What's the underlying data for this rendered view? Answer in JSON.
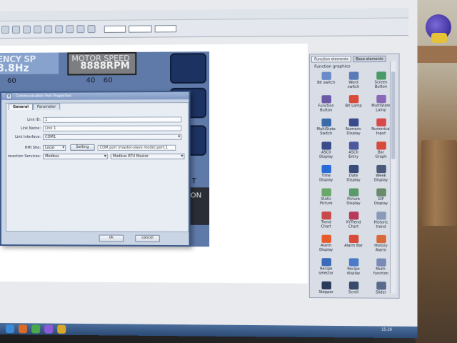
{
  "background": {
    "screen_color": "#e8eaee",
    "hmi_panel_color": "#5f7aa8",
    "accent_dialog": "#3d5a8a"
  },
  "toolbar": {
    "combo_1": "",
    "combo_2": "",
    "combo_3": ""
  },
  "hmi": {
    "frequency_label": "ENCY SP",
    "frequency_value": "8.8Hz",
    "motor_label": "MOTOR SPEED",
    "motor_value": "8888RPM",
    "gauge_left": "60",
    "gauge_mid_a": "40",
    "gauge_mid_b": "60",
    "side_text_1": "T",
    "side_text_2": "ON"
  },
  "dialog": {
    "title": "Communication Port Properties",
    "close_glyph": "×",
    "tabs": [
      {
        "label": "General"
      },
      {
        "label": "Parameter"
      }
    ],
    "fields": {
      "link_id_label": "Link ID:",
      "link_id_value": "1",
      "link_name_label": "Link Name:",
      "link_name_value": "Link 1",
      "link_interface_label": "Link Interface:",
      "link_interface_value": "COM1",
      "hmi_site_label": "HMI Site:",
      "hmi_site_value": "Local",
      "setting_button": "Setting",
      "com_port_text": "COM port (master-slave mode) port:1",
      "connection_services_label": "nnection Services:",
      "connection_services_value": "Modbus",
      "protocol_value": "Modbus RTU Master"
    },
    "ok_label": "ok",
    "cancel_label": "cancel"
  },
  "right_panel": {
    "tabs": [
      {
        "label": "Function elements"
      },
      {
        "label": "Base elements"
      }
    ],
    "heading": "Function graphics",
    "items": [
      {
        "label": "Bit switch",
        "icon": "bit-switch-icon",
        "color": "#6a8bc8"
      },
      {
        "label": "Word\nswitch",
        "icon": "word-switch-icon",
        "color": "#5a7ab8"
      },
      {
        "label": "Screen\nButton",
        "icon": "screen-button-icon",
        "color": "#4a9a6a"
      },
      {
        "label": "Function\nButton",
        "icon": "function-button-icon",
        "color": "#6a5aa8"
      },
      {
        "label": "Bit Lamp",
        "icon": "bit-lamp-icon",
        "color": "#d84a3a"
      },
      {
        "label": "MultiState\nLamp",
        "icon": "multistate-lamp-icon",
        "color": "#8a6ab8"
      },
      {
        "label": "MultiState\nSwitch",
        "icon": "multistate-switch-icon",
        "color": "#3a6aa8"
      },
      {
        "label": "Numeric\nDisplay",
        "icon": "numeric-display-icon",
        "color": "#3a4a8a"
      },
      {
        "label": "Numerical\nInput",
        "icon": "numerical-input-icon",
        "color": "#d84a4a"
      },
      {
        "label": "ASCII\nDisplay",
        "icon": "ascii-display-icon",
        "color": "#3a4a8a"
      },
      {
        "label": "ASCII\nEntry",
        "icon": "ascii-entry-icon",
        "color": "#4a5a9a"
      },
      {
        "label": "Bar\nGraph",
        "icon": "bar-graph-icon",
        "color": "#d84a3a"
      },
      {
        "label": "Time\nDisplay",
        "icon": "time-display-icon",
        "color": "#2a6ad8"
      },
      {
        "label": "Date\nDisplay",
        "icon": "date-display-icon",
        "color": "#3a4a7a"
      },
      {
        "label": "Week\nDisplay",
        "icon": "week-display-icon",
        "color": "#4a5a7a"
      },
      {
        "label": "Static\nPicture",
        "icon": "static-picture-icon",
        "color": "#6aa86a"
      },
      {
        "label": "Picture\nDisplay",
        "icon": "picture-display-icon",
        "color": "#5a9a6a"
      },
      {
        "label": "GIF\nDisplay",
        "icon": "gif-display-icon",
        "color": "#6a8a6a"
      },
      {
        "label": "Trend\nChart",
        "icon": "trend-chart-icon",
        "color": "#c84a4a"
      },
      {
        "label": "XYTrend\nChart",
        "icon": "xytrend-chart-icon",
        "color": "#b83a5a"
      },
      {
        "label": "Historic\ntrend",
        "icon": "historic-trend-icon",
        "color": "#8a9ab8"
      },
      {
        "label": "Alarm\nDisplay",
        "icon": "alarm-display-icon",
        "color": "#e85a2a"
      },
      {
        "label": "Alarm Bar",
        "icon": "alarm-bar-icon",
        "color": "#d84a3a"
      },
      {
        "label": "History\nAlarm",
        "icon": "history-alarm-icon",
        "color": "#d86a3a"
      },
      {
        "label": "Recipe\nselector",
        "icon": "recipe-selector-icon",
        "color": "#3a6ab8"
      },
      {
        "label": "Recipe\ndisplay",
        "icon": "recipe-display-icon",
        "color": "#4a7ac8"
      },
      {
        "label": "Multi-\nfunction",
        "icon": "multi-function-icon",
        "color": "#7a8ab8"
      },
      {
        "label": "Stepper",
        "icon": "stepper-icon",
        "color": "#2a3a5a"
      },
      {
        "label": "Scroll",
        "icon": "scroll-icon",
        "color": "#3a4a6a"
      },
      {
        "label": "Slider",
        "icon": "slider-icon",
        "color": "#5a6a8a"
      }
    ]
  },
  "taskbar": {
    "clock": "15:26"
  }
}
